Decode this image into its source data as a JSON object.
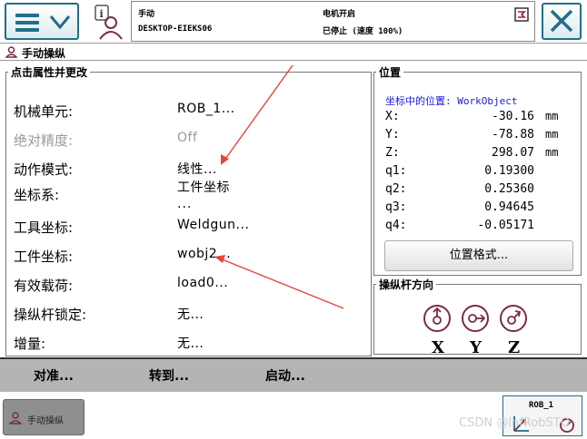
{
  "status": {
    "mode": "手动",
    "system_name": "DESKTOP-EIEKS06",
    "motor": "电机开启",
    "state": "已停止 (速度 100%)"
  },
  "page_title": "手动操纵",
  "properties": {
    "legend": "点击属性并更改",
    "rows": [
      {
        "label": "机械单元:",
        "value": "ROB_1..."
      },
      {
        "label": "绝对精度:",
        "value": "Off"
      },
      {
        "label": "动作模式:",
        "value": "线性..."
      },
      {
        "label": "坐标系:",
        "value": "工件坐标",
        "value2": "..."
      },
      {
        "label": "工具坐标:",
        "value": "Weldgun..."
      },
      {
        "label": "工件坐标:",
        "value": "wobj2..."
      },
      {
        "label": "有效载荷:",
        "value": "load0..."
      },
      {
        "label": "操纵杆锁定:",
        "value": "无..."
      },
      {
        "label": "增量:",
        "value": "无..."
      }
    ]
  },
  "position": {
    "legend": "位置",
    "frame_label": "坐标中的位置: WorkObject",
    "rows": [
      {
        "key": "X:",
        "value": "-30.16",
        "unit": "mm"
      },
      {
        "key": "Y:",
        "value": "-78.88",
        "unit": "mm"
      },
      {
        "key": "Z:",
        "value": "298.07",
        "unit": "mm"
      },
      {
        "key": "q1:",
        "value": "0.19300",
        "unit": ""
      },
      {
        "key": "q2:",
        "value": "0.25360",
        "unit": ""
      },
      {
        "key": "q3:",
        "value": "0.94645",
        "unit": ""
      },
      {
        "key": "q4:",
        "value": "-0.05171",
        "unit": ""
      }
    ],
    "format_button": "位置格式..."
  },
  "joystick": {
    "legend": "操纵杆方向",
    "axes": [
      "X",
      "Y",
      "Z"
    ]
  },
  "commands": [
    "对准...",
    "转到...",
    "启动..."
  ],
  "taskbar": {
    "jog_label": "手动操纵",
    "unit_label": "ROB_1"
  },
  "watermark": "CSDN @InfRobSTO",
  "colors": {
    "accent": "#1f6f8b",
    "frame_text": "#1a1adf",
    "arrow": "#e8453c",
    "disabled": "#9a9a9a"
  }
}
